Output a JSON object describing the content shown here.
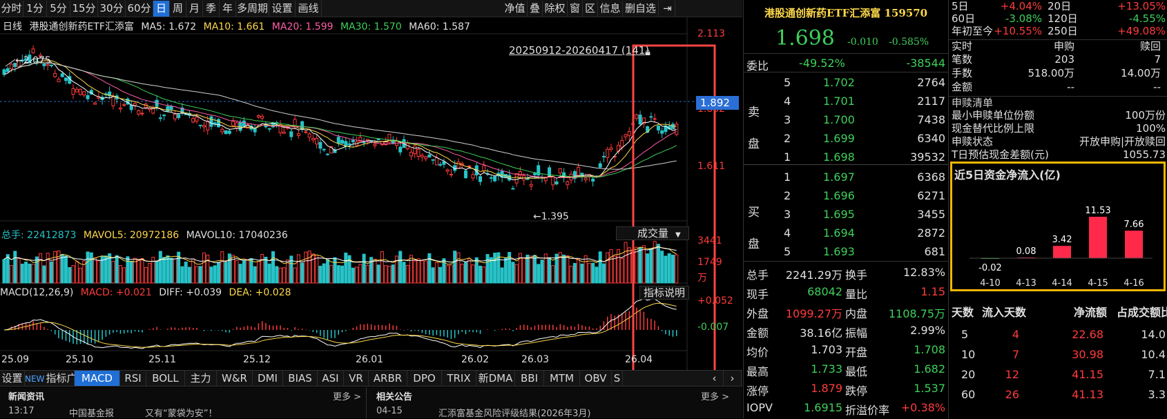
{
  "toolbar": {
    "periods": [
      "分时",
      "1分",
      "5分",
      "15分",
      "30分",
      "60分",
      "日",
      "周",
      "月",
      "季",
      "年",
      "多周期",
      "设置",
      "画线"
    ],
    "selected_period": "日",
    "right_buttons": [
      "净值",
      "叠",
      "除权",
      "窗",
      "区",
      "信息",
      "删自选"
    ],
    "exit_icon": "exit-icon"
  },
  "kline_legend": {
    "prefix": "日线",
    "name": "港股通创新药ETF汇添富",
    "ma5": "MA5: 1.672",
    "ma10": "MA10: 1.661",
    "ma20": "MA20: 1.599",
    "ma30": "MA30: 1.570",
    "ma60": "MA60: 1.587"
  },
  "colors": {
    "up": "#ff3b3b",
    "down": "#27c3c8",
    "ma5": "#ffffff",
    "ma10": "#ffd94a",
    "ma20": "#ff5fa8",
    "ma30": "#3fd05a",
    "ma60": "#d0d0d0",
    "selection_box": "#ff4444",
    "flow_box": "#f5b800",
    "price_label": "#2b6fd6"
  },
  "price_axis": {
    "high": "2.113",
    "mid": "1.862",
    "low": "1.611"
  },
  "current_price_label": "1.892",
  "annotations": {
    "max": "2.075",
    "min": "1.395",
    "range": "20250912-20260417 (141)",
    "lock_icon": "lock-icon"
  },
  "volume_legend": {
    "total": "总手: 22412873",
    "mavol5": "MAVOL5: 20972186",
    "mavol10": "MAVOL10: 17040236",
    "selector": "成交量"
  },
  "volume_axis": {
    "top": "3441",
    "mid": "1749",
    "unit": "万"
  },
  "macd_legend": {
    "title": "MACD(12,26,9)",
    "macd": "MACD: +0.021",
    "diff": "DIFF: +0.039",
    "dea": "DEA: +0.028",
    "help": "指标说明"
  },
  "macd_axis": {
    "top": "+0.052",
    "bottom": "-0.007"
  },
  "date_axis": [
    "25.09",
    "25.10",
    "25.11",
    "25.12",
    "26.01",
    "26.02",
    "26.03",
    "26.04"
  ],
  "indicator_tabs": [
    "设置",
    "指标广场",
    "MACD",
    "RSI",
    "BOLL",
    "主力",
    "W&R",
    "DMI",
    "BIAS",
    "ASI",
    "VR",
    "ARBR",
    "DPO",
    "TRIX",
    "新DMA",
    "BBI",
    "MTM",
    "OBV",
    "S"
  ],
  "new_badge": "NEW",
  "selected_indicator": "MACD",
  "news": {
    "title": "新闻资讯",
    "more": "更多 >",
    "time": "13:17",
    "source": "中国基金报",
    "headline": "又有“蒙袋为安”！"
  },
  "announce": {
    "title": "相关公告",
    "more": "更多 >",
    "date": "04-15",
    "headline": "汇添富基金风险评级结果(2026年3月)"
  },
  "quote": {
    "title": "港股通创新药ETF汇添富 159570",
    "price": "1.698",
    "change": "-0.010",
    "pct": "-0.585%",
    "weibi_label": "委比",
    "weibi": "-49.52%",
    "weicha": "-38544",
    "sell_label": [
      "卖",
      "盘"
    ],
    "buy_label": [
      "买",
      "盘"
    ],
    "sells": [
      {
        "lv": "5",
        "p": "1.702",
        "v": "2764"
      },
      {
        "lv": "4",
        "p": "1.701",
        "v": "2117"
      },
      {
        "lv": "3",
        "p": "1.700",
        "v": "7438"
      },
      {
        "lv": "2",
        "p": "1.699",
        "v": "6340"
      },
      {
        "lv": "1",
        "p": "1.698",
        "v": "39532"
      }
    ],
    "buys": [
      {
        "lv": "1",
        "p": "1.697",
        "v": "6368"
      },
      {
        "lv": "2",
        "p": "1.696",
        "v": "6271"
      },
      {
        "lv": "3",
        "p": "1.695",
        "v": "3455"
      },
      {
        "lv": "4",
        "p": "1.694",
        "v": "2872"
      },
      {
        "lv": "5",
        "p": "1.693",
        "v": "681"
      }
    ],
    "stats": [
      {
        "l1": "总手",
        "v1": "2241.29万",
        "l2": "换手",
        "v2": "12.83%"
      },
      {
        "l1": "现手",
        "v1": "68042",
        "l2": "量比",
        "v2": "1.15"
      },
      {
        "l1": "外盘",
        "v1": "1099.27万",
        "l2": "内盘",
        "v2": "1108.75万"
      },
      {
        "l1": "金额",
        "v1": "38.16亿",
        "l2": "振幅",
        "v2": "2.99%"
      },
      {
        "l1": "均价",
        "v1": "1.703",
        "l2": "开盘",
        "v2": "1.708"
      },
      {
        "l1": "最高",
        "v1": "1.733",
        "l2": "最低",
        "v2": "1.682"
      },
      {
        "l1": "涨停",
        "v1": "1.879",
        "l2": "跌停",
        "v2": "1.537"
      },
      {
        "l1": "IOPV",
        "v1": "1.6915",
        "l2": "折溢价率",
        "v2": "+0.38%"
      }
    ]
  },
  "perf": [
    {
      "l1": "5日",
      "v1": "+4.04%",
      "l2": "20日",
      "v2": "+13.05%"
    },
    {
      "l1": "60日",
      "v1": "-3.08%",
      "l2": "120日",
      "v2": "-4.55%"
    },
    {
      "l1": "年初至今",
      "v1": "+10.55%",
      "l2": "250日",
      "v2": "+49.08%"
    }
  ],
  "subscribe": {
    "header": [
      "实时",
      "申购",
      "赎回"
    ],
    "rows": [
      {
        "l": "笔数",
        "a": "203",
        "b": "7"
      },
      {
        "l": "手数",
        "a": "518.00万",
        "b": "14.00万"
      },
      {
        "l": "金额",
        "a": "--",
        "b": "--"
      }
    ],
    "list_title": "申赎清单",
    "details": [
      {
        "l": "最小申赎单位份额",
        "v": "100万份"
      },
      {
        "l": "现金替代比例上限",
        "v": "100%"
      },
      {
        "l": "申赎状态",
        "v": "开放申购|开放赎回"
      },
      {
        "l": "T日预估现金差额(元)",
        "v": "1055.73"
      }
    ]
  },
  "flow": {
    "title": "近5日资金净流入(亿)",
    "chart_data": {
      "type": "bar",
      "categories": [
        "4-10",
        "4-13",
        "4-14",
        "4-15",
        "4-16"
      ],
      "values": [
        -0.02,
        0.08,
        3.42,
        11.53,
        7.66
      ],
      "labels": [
        "-0.02",
        "0.08",
        "3.42",
        "11.53",
        "7.66"
      ]
    },
    "table": {
      "headers": [
        "天数",
        "流入天数",
        "净流额",
        "占成交额比"
      ],
      "rows": [
        {
          "d": "5",
          "n": "4",
          "a": "22.68",
          "p": "14.0"
        },
        {
          "d": "10",
          "n": "7",
          "a": "30.98",
          "p": "10.4"
        },
        {
          "d": "20",
          "n": "12",
          "a": "41.15",
          "p": "7.1"
        },
        {
          "d": "60",
          "n": "26",
          "a": "41.13",
          "p": "3.3"
        }
      ]
    }
  }
}
